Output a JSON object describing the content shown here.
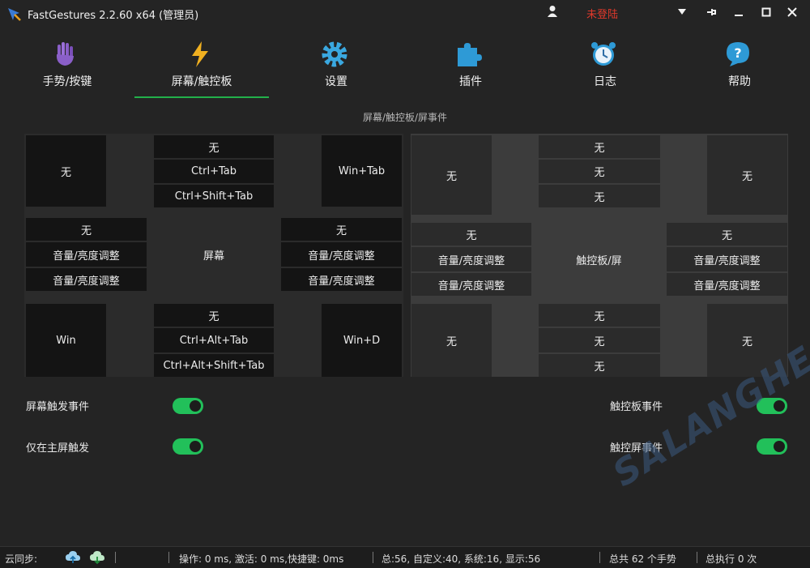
{
  "window": {
    "title": "FastGestures 2.2.60 x64 (管理员)",
    "login_status": "未登陆",
    "login_status_color": "#e0392b",
    "icons": [
      "user-icon",
      "dropdown-icon",
      "pin-icon",
      "minimize-icon",
      "maximize-icon",
      "close-icon"
    ]
  },
  "nav": {
    "active_color": "#22b04a",
    "tabs": [
      {
        "label": "手势/按键",
        "icon": "hand-icon"
      },
      {
        "label": "屏幕/触控板",
        "icon": "lightning-icon"
      },
      {
        "label": "设置",
        "icon": "gear-icon"
      },
      {
        "label": "插件",
        "icon": "puzzle-icon"
      },
      {
        "label": "日志",
        "icon": "alarm-clock-icon"
      },
      {
        "label": "帮助",
        "icon": "help-icon"
      }
    ]
  },
  "section_title": "屏幕/触控板/屏事件",
  "screen": {
    "top_left": "无",
    "top_mid": [
      "无",
      "Ctrl+Tab",
      "Ctrl+Shift+Tab"
    ],
    "top_right": "Win+Tab",
    "left": [
      "无",
      "音量/亮度调整",
      "音量/亮度调整"
    ],
    "center": "屏幕",
    "right": [
      "无",
      "音量/亮度调整",
      "音量/亮度调整"
    ],
    "bottom_left": "Win",
    "bottom_mid": [
      "无",
      "Ctrl+Alt+Tab",
      "Ctrl+Alt+Shift+Tab"
    ],
    "bottom_right": "Win+D"
  },
  "touchpad": {
    "top_left": "无",
    "top_mid": [
      "无",
      "无",
      "无"
    ],
    "top_right": "无",
    "left": [
      "无",
      "音量/亮度调整",
      "音量/亮度调整"
    ],
    "center": "触控板/屏",
    "right": [
      "无",
      "音量/亮度调整",
      "音量/亮度调整"
    ],
    "bottom_left": "无",
    "bottom_mid": [
      "无",
      "无",
      "无"
    ],
    "bottom_right": "无"
  },
  "options": {
    "screen_trigger": {
      "label": "屏幕触发事件",
      "on": true
    },
    "main_screen_only": {
      "label": "仅在主屏触发",
      "on": true
    },
    "touchpad_event": {
      "label": "触控板事件",
      "on": true
    },
    "touchscreen_event": {
      "label": "触控屏事件",
      "on": true
    },
    "toggle_color": "#22c05a"
  },
  "watermark": "SALANGHE",
  "status": {
    "cloud_sync": "云同步:",
    "timing": "操作: 0 ms, 激活: 0 ms,快捷键: 0ms",
    "counts": "总:56, 自定义:40, 系统:16, 显示:56",
    "total_gestures": "总共 62 个手势",
    "total_exec": "总执行 0 次"
  }
}
